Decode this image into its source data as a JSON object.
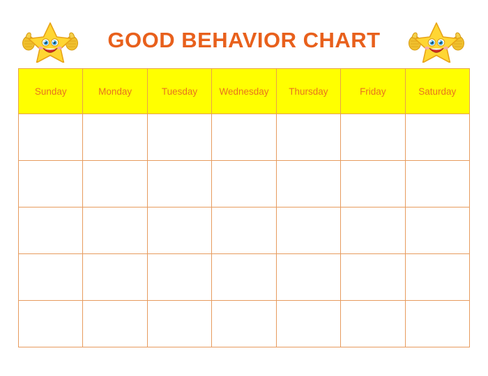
{
  "page": {
    "title": "GOOD BEHAVIOR CHART",
    "background_color": "#FFFFFF"
  },
  "colors": {
    "title_orange": "#E8601C",
    "header_fill_yellow": "#FFFF00",
    "header_text_orange": "#E8741E",
    "grid_border_orange": "#E79B5E",
    "cell_fill_white": "#FFFFFF",
    "star_body_yellow": "#FFD633",
    "star_outline_gold": "#E8A317",
    "star_eye_blue": "#3BA7E0",
    "star_mouth_red": "#D32F24",
    "star_cheek_pink": "#F4A6B8",
    "thumb_gold": "#F0C02E"
  },
  "mascots": [
    {
      "name": "star-mascot-left",
      "icon": "smiling-star-thumbs-up-icon"
    },
    {
      "name": "star-mascot-right",
      "icon": "smiling-star-thumbs-up-icon"
    }
  ],
  "chart": {
    "columns": [
      "Sunday",
      "Monday",
      "Tuesday",
      "Wednesday",
      "Thursday",
      "Friday",
      "Saturday"
    ],
    "row_count": 5,
    "rows": [
      [
        "",
        "",
        "",
        "",
        "",
        "",
        ""
      ],
      [
        "",
        "",
        "",
        "",
        "",
        "",
        ""
      ],
      [
        "",
        "",
        "",
        "",
        "",
        "",
        ""
      ],
      [
        "",
        "",
        "",
        "",
        "",
        "",
        ""
      ],
      [
        "",
        "",
        "",
        "",
        "",
        "",
        ""
      ]
    ]
  }
}
